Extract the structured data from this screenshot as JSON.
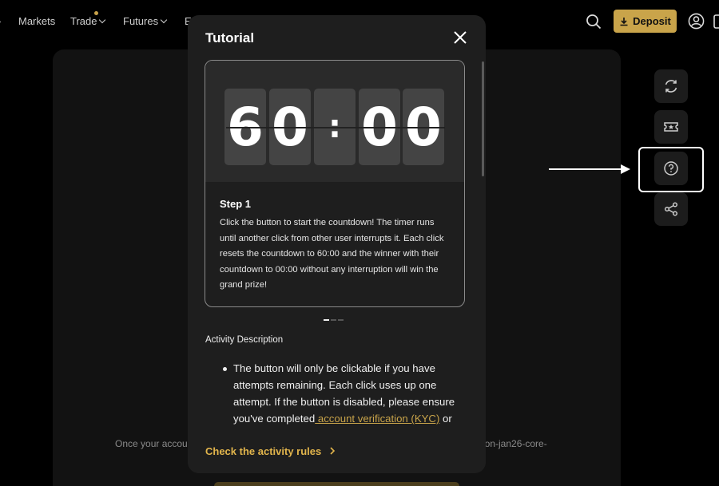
{
  "nav": {
    "items": [
      {
        "label": "Markets"
      },
      {
        "label": "Trade"
      },
      {
        "label": "Futures"
      },
      {
        "label": "E"
      }
    ],
    "deposit_label": "Deposit",
    "icons": {
      "search": "search-icon",
      "deposit": "download-icon",
      "account": "account-icon"
    }
  },
  "background": {
    "text_left": "Once your accou",
    "text_right": "tton-jan26-core-"
  },
  "side_actions": [
    "refresh-icon",
    "ticket-icon",
    "help-icon",
    "share-icon"
  ],
  "modal": {
    "title": "Tutorial",
    "timer": {
      "d1": "6",
      "d2": "0",
      "sep": ":",
      "d3": "0",
      "d4": "0"
    },
    "step_title": "Step 1",
    "step_text": "Click the button to start the countdown! The timer runs until another click from other user interrupts it. Each click resets the countdown to 60:00 and the winner with their countdown to 00:00 without any interruption will win the grand prize!",
    "pager": {
      "count": 3,
      "active": 1
    },
    "description_title": "Activity Description",
    "bullet_text_1": "The button will only be clickable if you have attempts remaining. Each click uses up one attempt. If the button is disabled, please ensure you've completed",
    "bullet_link": " account verification (KYC)",
    "bullet_text_2": " or complete the bonus tasks to earn",
    "rules_link": "Check the activity rules"
  },
  "colors": {
    "accent": "#c9a44a",
    "link": "#e2b54c",
    "modal_bg": "#1e1e1e"
  }
}
